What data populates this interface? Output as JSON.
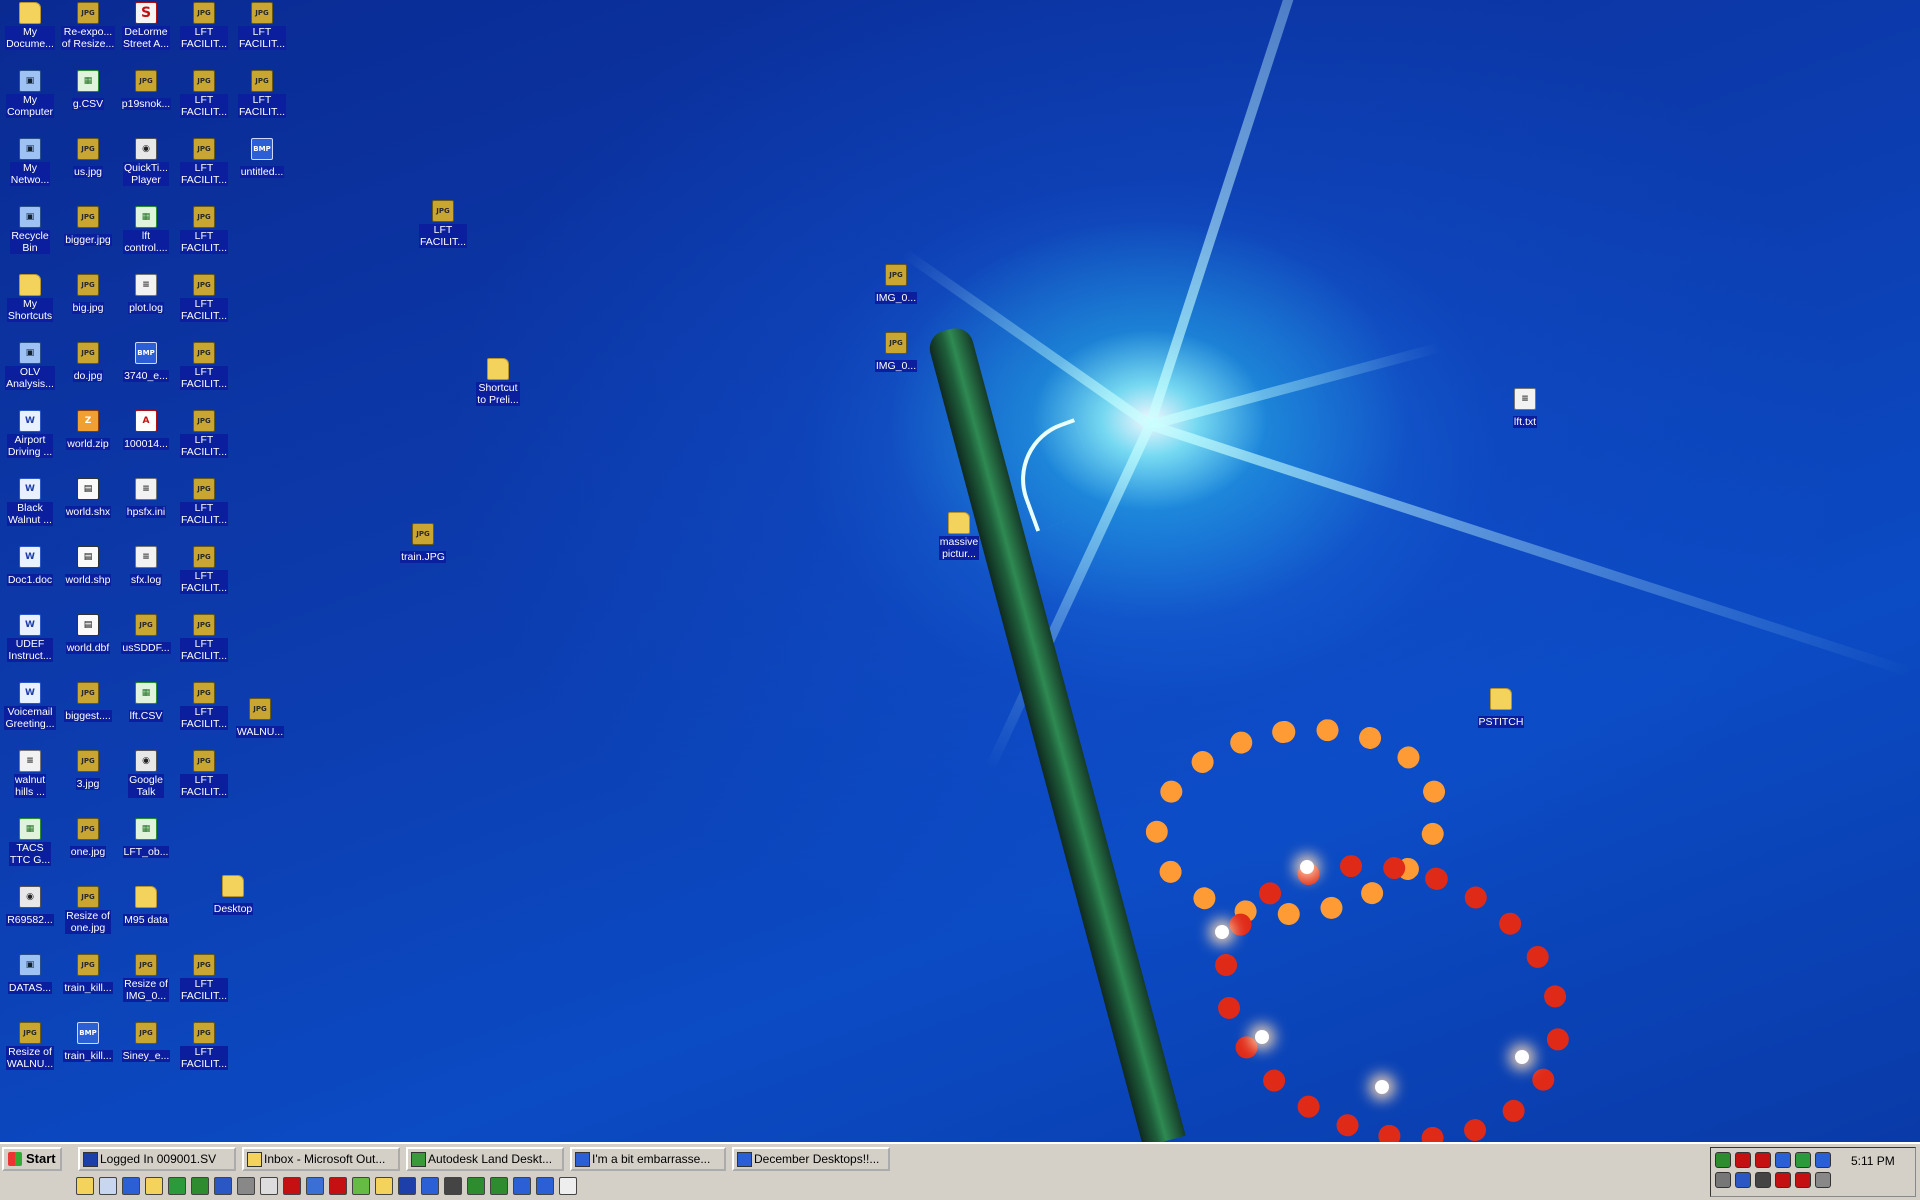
{
  "desktop_icons": [
    {
      "label": "My\nDocume...",
      "icon": "documents-folder-icon",
      "type": "folder"
    },
    {
      "label": "Re-expo...\nof Resize...",
      "icon": "jpg-file-icon",
      "type": "jpg"
    },
    {
      "label": "DeLorme\nStreet A...",
      "icon": "delorme-app-icon",
      "type": "red"
    },
    {
      "label": "LFT\nFACILIT...",
      "icon": "jpg-file-icon",
      "type": "jpg"
    },
    {
      "label": "LFT\nFACILIT...",
      "icon": "jpg-file-icon",
      "type": "jpg"
    },
    {
      "label": "My\nComputer",
      "icon": "computer-icon",
      "type": "sys"
    },
    {
      "label": "g.CSV",
      "icon": "csv-file-icon",
      "type": "csv"
    },
    {
      "label": "p19snok...",
      "icon": "jpg-file-icon",
      "type": "jpg"
    },
    {
      "label": "LFT\nFACILIT...",
      "icon": "jpg-file-icon",
      "type": "jpg"
    },
    {
      "label": "LFT\nFACILIT...",
      "icon": "jpg-file-icon",
      "type": "jpg"
    },
    {
      "label": "My\nNetwo...",
      "icon": "network-icon",
      "type": "sys"
    },
    {
      "label": "us.jpg",
      "icon": "jpg-file-icon",
      "type": "jpg"
    },
    {
      "label": "QuickTi...\nPlayer",
      "icon": "quicktime-icon",
      "type": "app"
    },
    {
      "label": "LFT\nFACILIT...",
      "icon": "jpg-file-icon",
      "type": "jpg"
    },
    {
      "label": "untitled...",
      "icon": "bmp-file-icon",
      "type": "bmp"
    },
    {
      "label": "Recycle\nBin",
      "icon": "recycle-bin-icon",
      "type": "sys"
    },
    {
      "label": "bigger.jpg",
      "icon": "jpg-file-icon",
      "type": "jpg"
    },
    {
      "label": "lft\ncontrol....",
      "icon": "csv-file-icon",
      "type": "csv"
    },
    {
      "label": "LFT\nFACILIT...",
      "icon": "jpg-file-icon",
      "type": "jpg"
    },
    {
      "label": "LFT\nFACILIT...",
      "icon": "jpg-file-icon",
      "type": "jpg"
    },
    {
      "label": "My\nShortcuts",
      "icon": "folder-icon",
      "type": "folder"
    },
    {
      "label": "big.jpg",
      "icon": "jpg-file-icon",
      "type": "jpg"
    },
    {
      "label": "plot.log",
      "icon": "text-file-icon",
      "type": "txt"
    },
    {
      "label": "LFT\nFACILIT...",
      "icon": "jpg-file-icon",
      "type": "jpg"
    },
    {
      "label": "IMG_0...",
      "icon": "jpg-file-icon",
      "type": "jpg"
    },
    {
      "label": "OLV\nAnalysis...",
      "icon": "app-icon",
      "type": "sys"
    },
    {
      "label": "do.jpg",
      "icon": "jpg-file-icon",
      "type": "jpg"
    },
    {
      "label": "3740_e...",
      "icon": "app-icon",
      "type": "bmp"
    },
    {
      "label": "LFT\nFACILIT...",
      "icon": "jpg-file-icon",
      "type": "jpg"
    },
    {
      "label": "IMG_0...",
      "icon": "jpg-file-icon",
      "type": "jpg"
    },
    {
      "label": "Shortcut\nto Preli...",
      "icon": "folder-shortcut-icon",
      "type": "folder"
    },
    {
      "label": "lft.txt",
      "icon": "text-file-icon",
      "type": "txt"
    },
    {
      "label": "Airport\nDriving ...",
      "icon": "word-doc-icon",
      "type": "doc"
    },
    {
      "label": "world.zip",
      "icon": "zip-file-icon",
      "type": "zip"
    },
    {
      "label": "100014...",
      "icon": "pdf-file-icon",
      "type": "pdf"
    },
    {
      "label": "LFT\nFACILIT...",
      "icon": "jpg-file-icon",
      "type": "jpg"
    },
    {
      "label": "Black\nWalnut ...",
      "icon": "word-doc-icon",
      "type": "doc"
    },
    {
      "label": "world.shx",
      "icon": "shx-file-icon",
      "type": "shp"
    },
    {
      "label": "hpsfx.ini",
      "icon": "ini-file-icon",
      "type": "txt"
    },
    {
      "label": "LFT\nFACILIT...",
      "icon": "jpg-file-icon",
      "type": "jpg"
    },
    {
      "label": "massive\npictur...",
      "icon": "folder-icon",
      "type": "folder"
    },
    {
      "label": "train.JPG",
      "icon": "jpg-file-icon",
      "type": "jpg"
    },
    {
      "label": "Doc1.doc",
      "icon": "word-doc-icon",
      "type": "doc"
    },
    {
      "label": "world.shp",
      "icon": "shp-file-icon",
      "type": "shp"
    },
    {
      "label": "sfx.log",
      "icon": "text-file-icon",
      "type": "txt"
    },
    {
      "label": "LFT\nFACILIT...",
      "icon": "jpg-file-icon",
      "type": "jpg"
    },
    {
      "label": "UDEF\nInstruct...",
      "icon": "word-doc-icon",
      "type": "doc"
    },
    {
      "label": "world.dbf",
      "icon": "dbf-file-icon",
      "type": "shp"
    },
    {
      "label": "usSDDF...",
      "icon": "jpg-file-icon",
      "type": "jpg"
    },
    {
      "label": "LFT\nFACILIT...",
      "icon": "jpg-file-icon",
      "type": "jpg"
    },
    {
      "label": "Voicemail\nGreeting...",
      "icon": "word-doc-icon",
      "type": "doc"
    },
    {
      "label": "biggest....",
      "icon": "jpg-file-icon",
      "type": "jpg"
    },
    {
      "label": "lft.CSV",
      "icon": "csv-file-icon",
      "type": "csv"
    },
    {
      "label": "LFT\nFACILIT...",
      "icon": "jpg-file-icon",
      "type": "jpg"
    },
    {
      "label": "WALNU...",
      "icon": "jpg-file-icon",
      "type": "jpg"
    },
    {
      "label": "PSTITCH",
      "icon": "folder-icon",
      "type": "folder"
    },
    {
      "label": "walnut\nhills ...",
      "icon": "text-file-icon",
      "type": "txt"
    },
    {
      "label": "3.jpg",
      "icon": "jpg-file-icon",
      "type": "jpg"
    },
    {
      "label": "Google\nTalk",
      "icon": "google-talk-icon",
      "type": "app"
    },
    {
      "label": "LFT\nFACILIT...",
      "icon": "jpg-file-icon",
      "type": "jpg"
    },
    {
      "label": "TACS\nTTC G...",
      "icon": "csv-file-icon",
      "type": "csv"
    },
    {
      "label": "one.jpg",
      "icon": "jpg-file-icon",
      "type": "jpg"
    },
    {
      "label": "LFT_ob...",
      "icon": "csv-file-icon",
      "type": "csv"
    },
    {
      "label": "R69582...",
      "icon": "app-icon",
      "type": "app"
    },
    {
      "label": "Resize of\none.jpg",
      "icon": "jpg-file-icon",
      "type": "jpg"
    },
    {
      "label": "M95 data",
      "icon": "folder-icon",
      "type": "folder"
    },
    {
      "label": "Desktop",
      "icon": "folder-shortcut-icon",
      "type": "folder"
    },
    {
      "label": "DATAS...",
      "icon": "app-icon",
      "type": "sys"
    },
    {
      "label": "train_kill...",
      "icon": "jpg-file-icon",
      "type": "jpg"
    },
    {
      "label": "Resize of\nIMG_0...",
      "icon": "jpg-file-icon",
      "type": "jpg"
    },
    {
      "label": "LFT\nFACILIT...",
      "icon": "jpg-file-icon",
      "type": "jpg"
    },
    {
      "label": "Resize of\nWALNU...",
      "icon": "jpg-file-icon",
      "type": "jpg"
    },
    {
      "label": "train_kill...",
      "icon": "bmp-file-icon",
      "type": "bmp"
    },
    {
      "label": "Siney_e...",
      "icon": "jpg-file-icon",
      "type": "jpg"
    },
    {
      "label": "LFT\nFACILIT...",
      "icon": "jpg-file-icon",
      "type": "jpg"
    }
  ],
  "taskbar": {
    "start_label": "Start",
    "tasks": [
      {
        "label": "Logged In 009001.SV",
        "icon": "app-window-icon",
        "color": "#1d3fa9"
      },
      {
        "label": "Inbox - Microsoft Out...",
        "icon": "outlook-icon",
        "color": "#f3d35c"
      },
      {
        "label": "Autodesk Land Deskt...",
        "icon": "autodesk-icon",
        "color": "#3a9a3a"
      },
      {
        "label": "I'm a bit embarrasse...",
        "icon": "browser-icon",
        "color": "#2b5fd6"
      },
      {
        "label": "December Desktops!!...",
        "icon": "browser-icon",
        "color": "#2b5fd6"
      }
    ],
    "clock": "5:11 PM",
    "quick_launch": [
      "show-desktop-icon",
      "explorer-icon",
      "ie-icon",
      "outlook-icon",
      "media-icon",
      "excel-icon",
      "word-icon",
      "calc-icon",
      "notepad-icon",
      "acrobat-icon",
      "photoshop-icon",
      "autocad-icon",
      "app-icon",
      "folder-icon",
      "map-icon",
      "network-icon",
      "camera-icon",
      "email-icon",
      "chart-icon",
      "ie-icon",
      "ie-icon",
      "chat-icon"
    ],
    "tray_icons": [
      "network-icon",
      "antivirus-icon",
      "norton-icon",
      "sync-icon",
      "messenger-icon",
      "network-icon",
      "security-icon",
      "shield-icon",
      "volume-icon",
      "update-icon",
      "mail-icon",
      "printer-icon"
    ]
  }
}
